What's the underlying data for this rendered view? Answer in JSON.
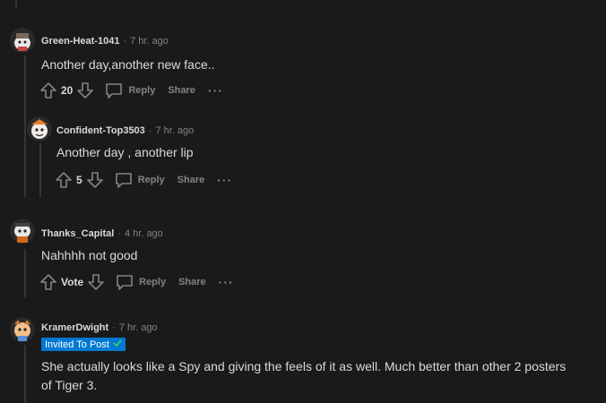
{
  "comments": [
    {
      "username": "Green-Heat-1041",
      "time": "7 hr. ago",
      "body": "Another day,another new face..",
      "votes": "20",
      "reply": "Reply",
      "share": "Share"
    },
    {
      "username": "Confident-Top3503",
      "time": "7 hr. ago",
      "body": "Another day , another lip",
      "votes": "5",
      "reply": "Reply",
      "share": "Share"
    },
    {
      "username": "Thanks_Capital",
      "time": "4 hr. ago",
      "body": "Nahhhh not good",
      "votes": "Vote",
      "reply": "Reply",
      "share": "Share"
    },
    {
      "username": "KramerDwight",
      "time": "7 hr. ago",
      "badge": "Invited To Post",
      "body": "She actually looks like a Spy and giving the feels of it as well. Much better than other 2 posters of Tiger 3."
    }
  ],
  "separator": "·",
  "more": "···",
  "colors": {
    "background": "#1a1a1b",
    "text": "#d7dadc",
    "muted": "#818384",
    "badge": "#0079d3",
    "threadline": "#343536"
  }
}
